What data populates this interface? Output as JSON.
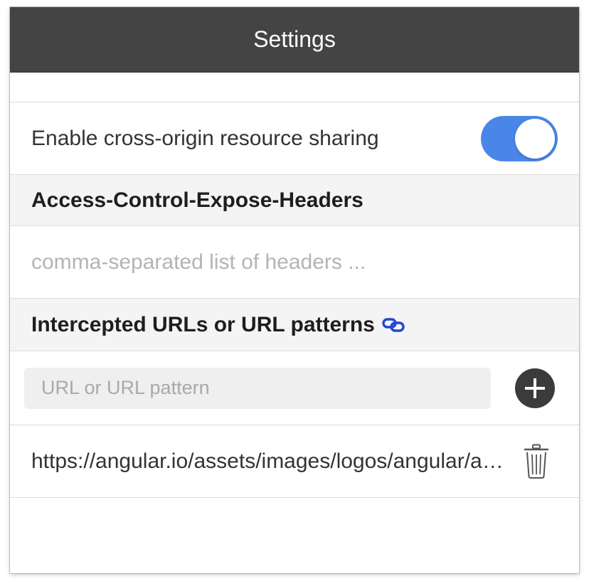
{
  "header": {
    "title": "Settings"
  },
  "cors": {
    "label": "Enable cross-origin resource sharing",
    "enabled": true,
    "toggle_color": "#4a86e8"
  },
  "expose_headers": {
    "title": "Access-Control-Expose-Headers",
    "value": "",
    "placeholder": "comma-separated list of headers ..."
  },
  "intercepted": {
    "title": "Intercepted URLs or URL patterns",
    "title_icon": "link-icon",
    "link_color": "#2346d6",
    "input_placeholder": "URL or URL pattern",
    "add_icon": "plus-circle-icon",
    "delete_icon": "trash-icon",
    "items": [
      {
        "url": "https://angular.io/assets/images/logos/angular/angular.svg"
      }
    ]
  }
}
